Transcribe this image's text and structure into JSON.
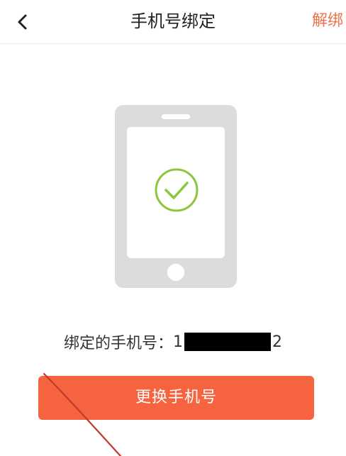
{
  "navbar": {
    "back_icon": "chevron-left-icon",
    "title": "手机号绑定",
    "action_label": "解绑",
    "action_color": "#f0714a"
  },
  "illustration": {
    "icon": "phone-check-icon",
    "phone_color": "#dcdcdc",
    "check_color": "#8cc63f"
  },
  "binding": {
    "label": "绑定的手机号：",
    "number_prefix": "1",
    "number_suffix": "2"
  },
  "change_button": {
    "label": "更换手机号",
    "color": "#f6633f"
  }
}
